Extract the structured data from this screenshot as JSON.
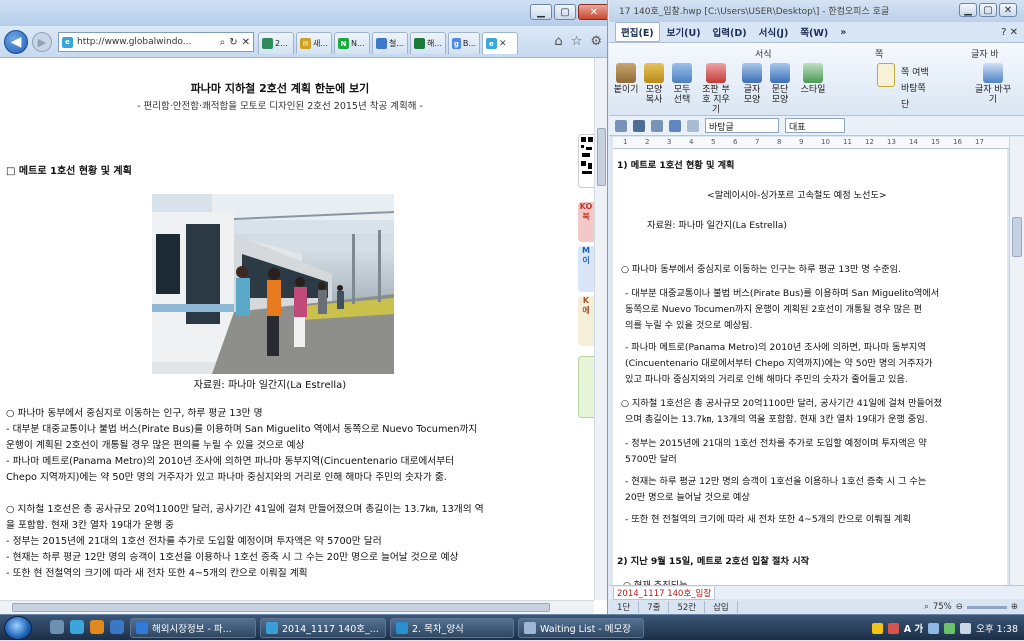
{
  "ie": {
    "address": "http://www.globalwindo...",
    "addr_icons": [
      "search-icon",
      "refresh-icon",
      "stop-icon"
    ],
    "tabs": [
      {
        "label": "2...",
        "color": "#2e8b57"
      },
      {
        "label": "새...",
        "color": "#d0a020"
      },
      {
        "label": "N...",
        "color": "#1bab3a"
      },
      {
        "label": "철...",
        "color": "#3c7ac9"
      },
      {
        "label": "해...",
        "color": "#1a7a3a"
      },
      {
        "label": "B...",
        "color": "#4f87ea"
      },
      {
        "label": "",
        "color": "#3aa6d9",
        "active": true
      }
    ],
    "tools": [
      "home-icon",
      "star-icon",
      "gear-icon"
    ],
    "content": {
      "title": "파나마 지하철 2호선 계획 한눈에 보기",
      "subtitle": "- 편리함·안전함·쾌적함을 모토로 디자인된 2호선 2015년 착공 계획해 -",
      "section": "□ 메트로 1호선 현황 및 계획",
      "caption": "자료원: 파나마 일간지(La Estrella)",
      "lines": [
        "○ 파나마 동부에서 중심지로 이동하는 인구, 하루 평균 13만 명",
        " - 대부분 대중교통이나 불법 버스(Pirate Bus)를 이용하며 San Miguelito 역에서 동쪽으로 Nuevo Tocumen까지",
        "   운행이 계획된 2호선이 개통될 경우 많은 편의를 누릴 수 있을 것으로 예상",
        " - 파나마 메트로(Panama Metro)의 2010년 조사에 의하면 파나마 동부지역(Cincuentenario 대로에서부터",
        "   Chepo 지역까지)에는 약 50만 명의 거주자가 있고 파나마 중심지와의 거리로 인해 해마다 주민의 숫자가 줆.",
        "",
        "○ 지하철 1호선은 총 공사규모 20억1100만 달러, 공사기간 41일에 걸쳐 만들어졌으며 총길이는 13.7㎞, 13개의 역",
        "   을 포함함. 현재 3칸 열차 19대가 운행 중",
        " - 정부는 2015년에 21대의 1호선 전차를 추가로 도입할 예정이며 투자액은 약 5700만 달러",
        " - 현재는 하루 평균 12만 명의 승객이 1호선을 이용하나 1호선 증축 시 그 수는 20만 명으로 늘어날 것으로 예상",
        " - 또한 현 전철역의 크기에 따라 새 전차 또한 4~5개의 칸으로 이뤄질 계획"
      ]
    },
    "side_snippets": [
      "KO 북",
      "M 이",
      "K 에",
      ""
    ]
  },
  "hwp": {
    "title": "17 140호_입찰.hwp [C:\\Users\\USER\\Desktop\\] - 한컴오피스 호글",
    "menus": [
      "편집(E)",
      "보기(U)",
      "입력(D)",
      "서식(J)",
      "쪽(W)",
      "»"
    ],
    "ribbon": {
      "buttons": [
        "붙이기",
        "모양 복사",
        "모두 선택",
        "조판 부호 지우기",
        "글자 모양",
        "문단 모양",
        "스타일"
      ],
      "group_label": "서식",
      "page_group_label": "쪽",
      "page_items": [
        "쪽 여백",
        "바탕쪽",
        "단"
      ],
      "right_group_label": "글자 바",
      "right_button": "글자 바꾸기"
    },
    "style_combo": "바탕글",
    "font_combo": "대표",
    "ruler_numbers": [
      "1",
      "2",
      "3",
      "4",
      "5",
      "6",
      "7",
      "8",
      "9",
      "10",
      "11",
      "12",
      "13",
      "14",
      "15",
      "16",
      "17"
    ],
    "doc": {
      "heading": "1) 메트로 1호선 현황 및 계획",
      "subheading": "<말레이시아-싱가포르 고속철도 예정 노선도>",
      "source": "자료원: 파나마 일간지(La Estrella)",
      "lines": [
        "○ 파나마 동부에서 중심지로 이동하는 인구는 하루 평균 13만 명 수준임.",
        " - 대부분 대중교통이나 불법 버스(Pirate Bus)를 이용하며 San Miguelito역에서",
        "   동쪽으로 Nuevo Tocumen까지 운행이 계획된 2호선이 개통될 경우 많은 편",
        "   의를 누릴 수 있을 것으로 예상됨.",
        " - 파나마 메트로(Panama Metro)의 2010년 조사에 의하면, 파나마 동부지역",
        "   (Cincuentenario 대로에서부터 Chepo 지역까지)에는 약 50만 명의 거주자가",
        "   있고 파나마 중심지와의 거리로 인해 해마다 주민의 숫자가 줄어들고 있음.",
        "○ 지하철 1호선은 총 공사규모 20억1100만 달러, 공사기간 41일에 걸쳐 만들어졌",
        "   으며 총길이는 13.7㎞, 13개의 역을 포함함. 현재 3칸 열차 19대가 운행 중임.",
        " - 정부는 2015년에 21대의 1호선 전차를 추가로 도입할 예정이며 투자액은 약",
        "   5700만 달러",
        " - 현재는 하루 평균 12만 명의 승객이 1호선을 이용하나 1호선 증축 시 그 수는",
        "   20만 명으로 늘어날 것으로 예상",
        " - 또한 현 전철역의 크기에 따라 새 전차 또한 4~5개의 칸으로 이뤄질 계획"
      ],
      "heading2": "2) 지난 9월 15일, 메트로 2호선 입찰 절차 시작",
      "partial": "○ 현재 추진되는"
    },
    "tab_name": "2014_1117 140호_입찰",
    "status": {
      "page": "1단",
      "line": "7줄",
      "col": "52칸",
      "mode": "삽입",
      "zoom": "75%"
    }
  },
  "taskbar": {
    "tasks": [
      {
        "label": "해외시장정보 - 파...",
        "color": "#2f7bd6"
      },
      {
        "label": "2014_1117 140호_...",
        "color": "#3a9dd8"
      },
      {
        "label": "2. 목차_양식",
        "color": "#2a8fcf"
      },
      {
        "label": "Waiting List - 메모장",
        "color": "#9fb7d6"
      }
    ],
    "tray_text": "A 가",
    "clock": "오후 1:38"
  }
}
